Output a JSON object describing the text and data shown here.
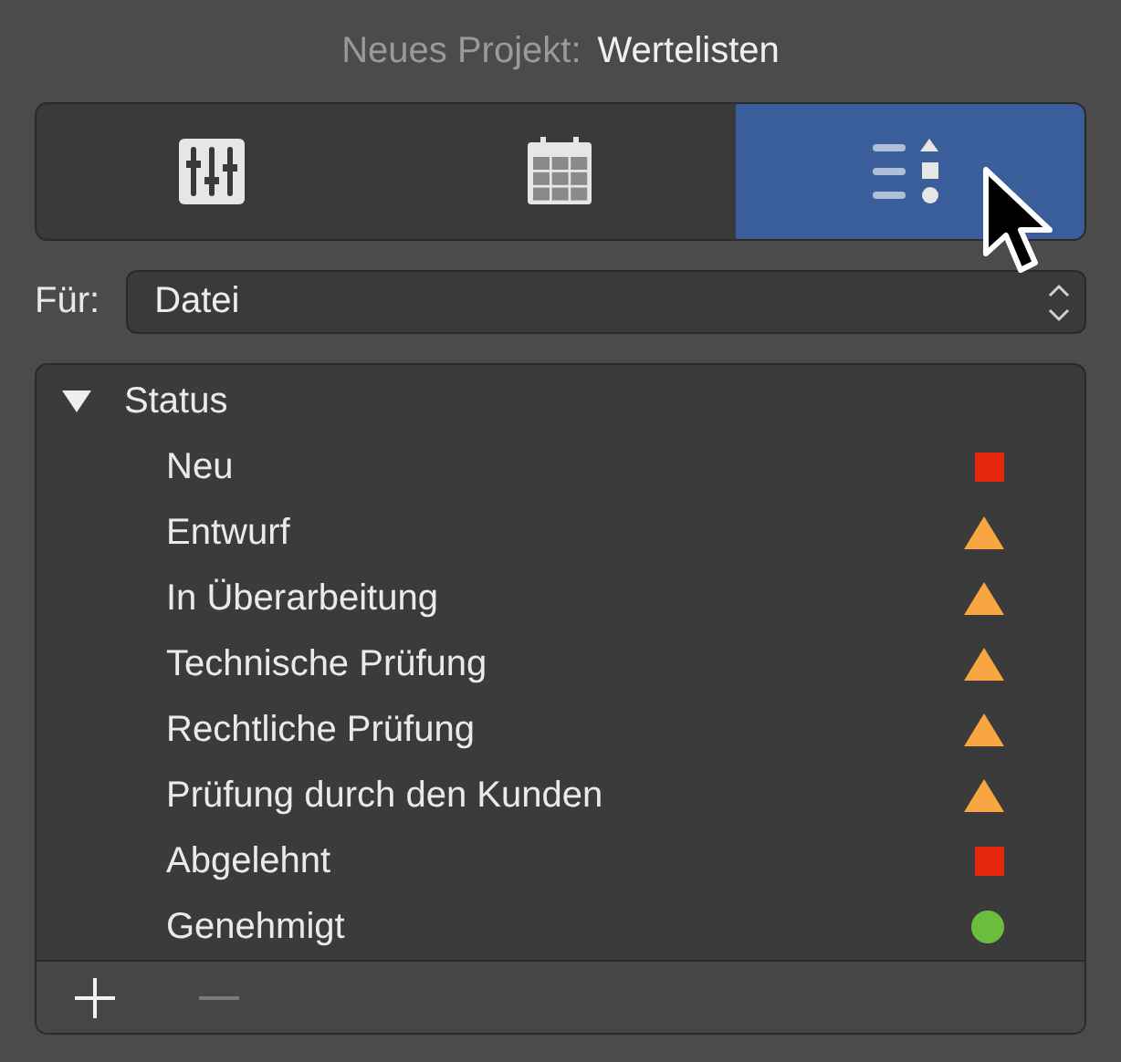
{
  "header": {
    "prefix": "Neues Projekt:",
    "title": "Wertelisten"
  },
  "tabs": [
    {
      "kind": "sliders",
      "selected": false
    },
    {
      "kind": "calendar",
      "selected": false
    },
    {
      "kind": "list",
      "selected": true
    }
  ],
  "for_field": {
    "label": "Für:",
    "value": "Datei"
  },
  "tree": [
    {
      "label": "Status",
      "expanded": true,
      "children": [
        {
          "label": "Neu",
          "kind": "square",
          "color": "#e5260f"
        },
        {
          "label": "Entwurf",
          "kind": "triangle",
          "color": "#f7a642"
        },
        {
          "label": "In Überarbeitung",
          "kind": "triangle",
          "color": "#f7a642"
        },
        {
          "label": "Technische Prüfung",
          "kind": "triangle",
          "color": "#f7a642"
        },
        {
          "label": "Rechtliche Prüfung",
          "kind": "triangle",
          "color": "#f7a642"
        },
        {
          "label": "Prüfung durch den Kunden",
          "kind": "triangle",
          "color": "#f7a642"
        },
        {
          "label": "Abgelehnt",
          "kind": "square",
          "color": "#e5260f"
        },
        {
          "label": "Genehmigt",
          "kind": "circle",
          "color": "#6bbd3e"
        }
      ]
    }
  ],
  "footer": [
    {
      "kind": "add",
      "disabled": false
    },
    {
      "kind": "remove",
      "disabled": true
    }
  ]
}
